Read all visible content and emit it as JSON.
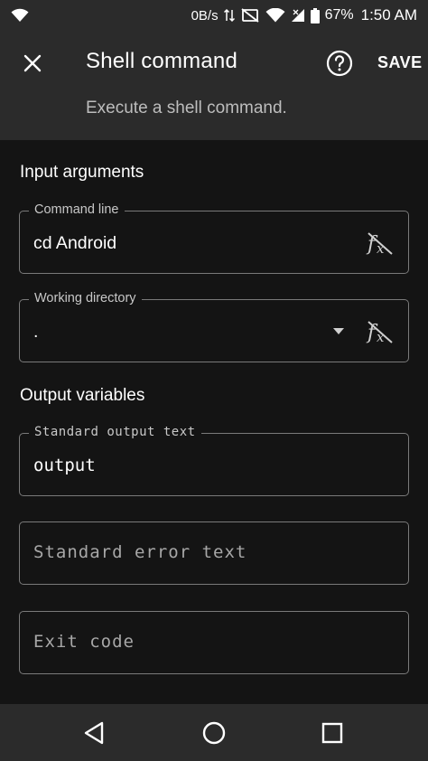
{
  "status_bar": {
    "net_speed": "0B/s",
    "battery": "67%",
    "time": "1:50 AM"
  },
  "app_bar": {
    "title": "Shell command",
    "subtitle": "Execute a shell command.",
    "save_label": "SAVE"
  },
  "input_section": {
    "title": "Input arguments",
    "command_line": {
      "label": "Command line",
      "value": "cd Android"
    },
    "working_directory": {
      "label": "Working directory",
      "value": "."
    }
  },
  "output_section": {
    "title": "Output variables",
    "stdout": {
      "label": "Standard output text",
      "value": "output"
    },
    "stderr": {
      "placeholder": "Standard error text"
    },
    "exit_code": {
      "placeholder": "Exit code"
    }
  },
  "icons": {
    "close": "close-icon",
    "help": "help-icon",
    "fx": "function-icon",
    "dropdown": "dropdown-arrow-icon",
    "back": "back-icon",
    "home": "home-icon",
    "recents": "recents-icon"
  }
}
